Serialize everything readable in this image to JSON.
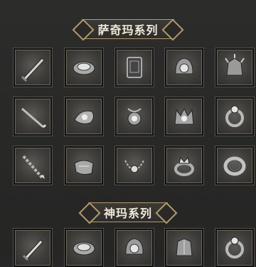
{
  "sections": [
    {
      "title": "萨奇玛系列",
      "rows": [
        [
          "blade-icon",
          "bracer-icon",
          "tome-icon",
          "helm-icon",
          "spiked-armor-icon"
        ],
        [
          "staff-icon",
          "gauntlet-icon",
          "amulet-icon",
          "crown-icon",
          "ring-icon"
        ],
        [
          "spear-icon",
          "boots-icon",
          "necklace-icon",
          "crowned-ring-icon",
          "band-ring-icon"
        ]
      ]
    },
    {
      "title": "神玛系列",
      "rows": [
        [
          "sword-icon",
          "bracer-icon",
          "helm-icon",
          "armor-icon",
          "ring-icon"
        ]
      ]
    }
  ]
}
